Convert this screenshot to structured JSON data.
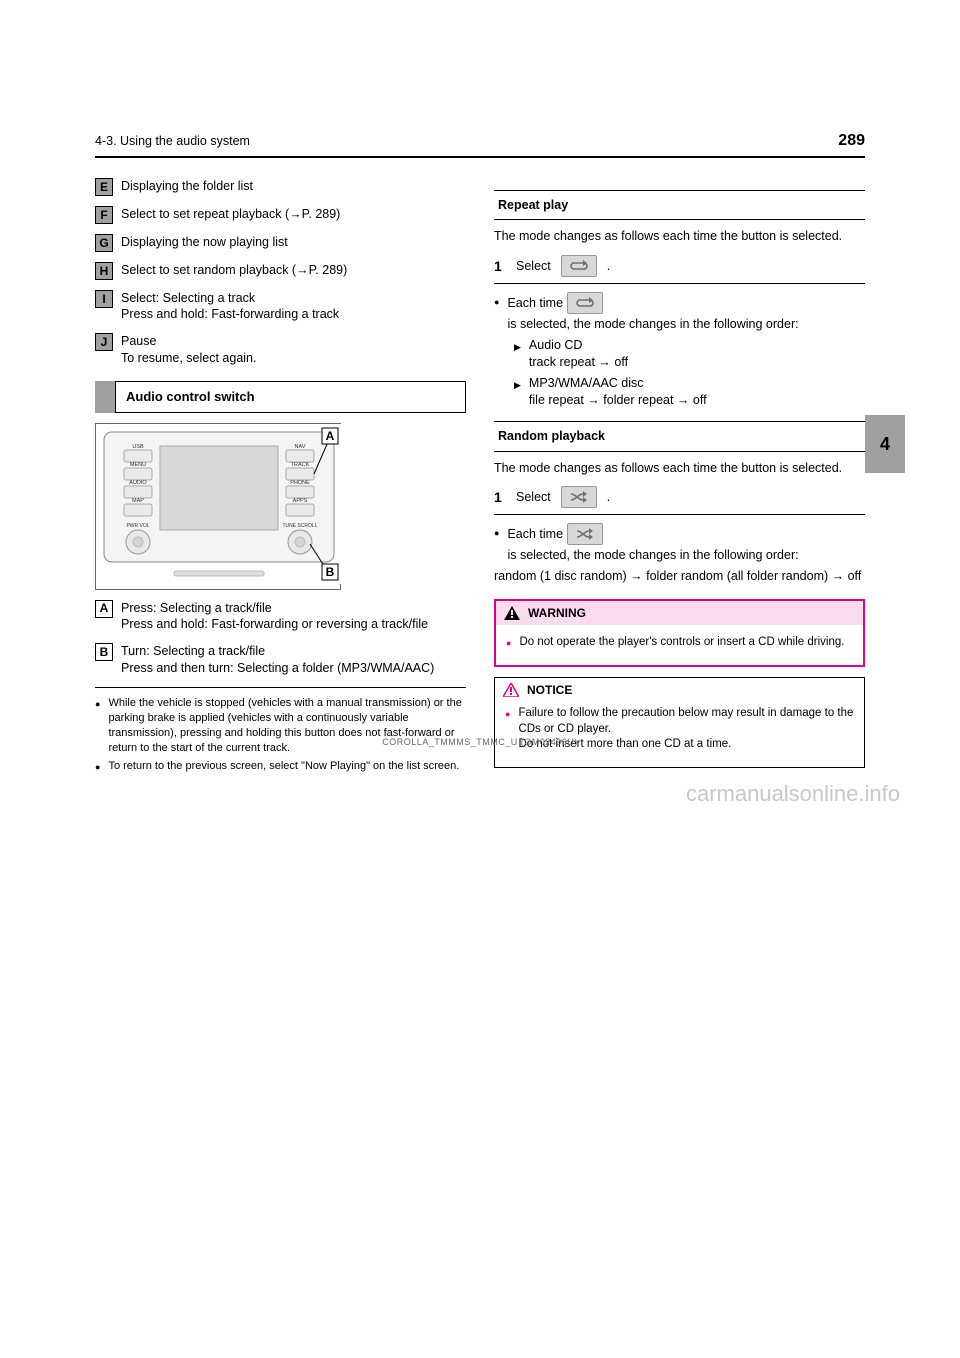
{
  "page_number": "289",
  "header_title": "4-3. Using the audio system",
  "side_tab": "4",
  "left": {
    "items": [
      {
        "letter": "E",
        "text": "Displaying the folder list"
      },
      {
        "letter": "F",
        "text": "Select to set repeat playback (→P. 289)"
      },
      {
        "letter": "G",
        "text": "Displaying the now playing list"
      },
      {
        "letter": "H",
        "text": "Select to set random playback (→P. 289)"
      },
      {
        "letter": "I",
        "text": "Select: Selecting a track\nPress and hold: Fast-forwarding a track"
      },
      {
        "letter": "J",
        "text": "Pause\nTo resume, select again."
      }
    ],
    "section_label": "Audio control switch",
    "fig": {
      "callout_a": "A",
      "callout_b": "B",
      "left_btns": [
        "USB",
        "MENU",
        "AUDIO",
        "MAP"
      ],
      "right_btns": [
        "NAV",
        "TRACK",
        "PHONE",
        "APPS"
      ],
      "knob_l": "PWR  VOL",
      "knob_r": "TUNE  SCROLL"
    },
    "items2": [
      {
        "letter": "A",
        "text": "Press: Selecting a track/file\nPress and hold: Fast-forwarding or reversing a track/file"
      },
      {
        "letter": "B",
        "text": "Turn: Selecting a track/file\nPress and then turn: Selecting a folder (MP3/WMA/AAC)"
      }
    ],
    "notes": [
      "While the vehicle is stopped (vehicles with a manual transmission) or the parking brake is applied (vehicles with a continuously variable transmission), pressing and holding this button does not fast-forward or return to the start of the current track.",
      "To return to the previous screen, select \"Now Playing\" on the list screen."
    ]
  },
  "right": {
    "repeat": {
      "title": "Repeat play",
      "mode_line": "The mode changes as follows each time the button is selected.",
      "step_prefix": "Select ",
      "step_suffix": ".",
      "each_prefix": "Each time ",
      "each_suffix": " is selected, the mode changes in the following order:",
      "audio_cd_label": "Audio CD",
      "audio_cd_seq": "track repeat → off",
      "mp3_label": "MP3/WMA/AAC disc",
      "mp3_seq": "file repeat → folder repeat → off"
    },
    "random": {
      "title": "Random playback",
      "mode_line": "The mode changes as follows each time the button is selected.",
      "step_prefix": "Select ",
      "step_suffix": ".",
      "each_prefix": "Each time ",
      "each_suffix": " is selected, the mode changes in the following order:",
      "seq": "random (1 disc random) → folder random (all folder random) → off"
    },
    "warning": {
      "label": "WARNING",
      "body": "Do not operate the player's controls or insert a CD while driving."
    },
    "notice": {
      "label": "NOTICE",
      "body": "Failure to follow the precaution below may result in damage to the CDs or CD player.\nDo not insert more than one CD at a time."
    }
  },
  "footer": "COROLLA_TMMMS_TMMC_U (OM02496U)",
  "watermark": "carmanualsonline.info"
}
